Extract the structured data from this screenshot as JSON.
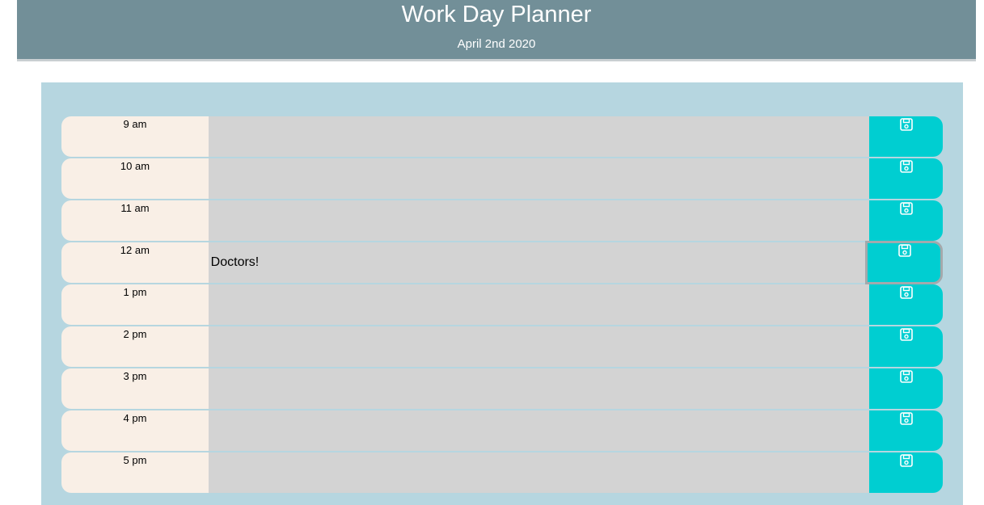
{
  "header": {
    "title": "Work Day Planner",
    "date": "April 2nd 2020"
  },
  "colors": {
    "header_bg": "#728f98",
    "planner_bg": "#b6d6e0",
    "hour_bg": "#f9efe6",
    "description_bg": "#d3d3d3",
    "save_bg": "#00ced1"
  },
  "rows": [
    {
      "hour": "9 am",
      "description": "",
      "save_icon": "floppy-disk-icon"
    },
    {
      "hour": "10 am",
      "description": "",
      "save_icon": "floppy-disk-icon"
    },
    {
      "hour": "11 am",
      "description": "",
      "save_icon": "floppy-disk-icon"
    },
    {
      "hour": "12 am",
      "description": "Doctors!",
      "save_icon": "floppy-disk-icon"
    },
    {
      "hour": "1 pm",
      "description": "",
      "save_icon": "floppy-disk-icon"
    },
    {
      "hour": "2 pm",
      "description": "",
      "save_icon": "floppy-disk-icon"
    },
    {
      "hour": "3 pm",
      "description": "",
      "save_icon": "floppy-disk-icon"
    },
    {
      "hour": "4 pm",
      "description": "",
      "save_icon": "floppy-disk-icon"
    },
    {
      "hour": "5 pm",
      "description": "",
      "save_icon": "floppy-disk-icon"
    }
  ],
  "focused_row": 3
}
